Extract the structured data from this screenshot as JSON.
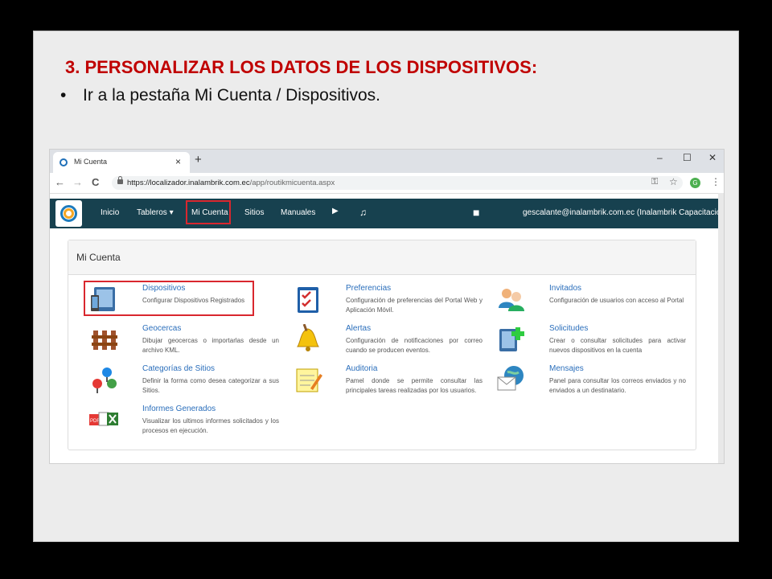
{
  "slide": {
    "title": "3. PERSONALIZAR LOS DATOS DE LOS DISPOSITIVOS:",
    "bullet_symbol": "•",
    "bullet_text": "Ir a la pestaña Mi Cuenta / Dispositivos."
  },
  "browser": {
    "tab_title": "Mi Cuenta",
    "tab_close": "×",
    "new_tab": "+",
    "minimize": "–",
    "maximize": "☐",
    "close": "✕",
    "back": "←",
    "forward": "→",
    "reload": "C",
    "url_main": "https://localizador.inalambrik.com.ec",
    "url_path": "/app/routikmicuenta.aspx",
    "key_icon": "⚿",
    "star_icon": "☆",
    "avatar_letter": "G",
    "menu_icon": "⋮"
  },
  "nav": {
    "items": [
      "Inicio",
      "Tableros ▾",
      "Mi Cuenta",
      "Sitios",
      "Manuales"
    ],
    "youtube_icon": "▶",
    "support_icon": "♫",
    "chat_icon": "■",
    "user": "gescalante@inalambrik.com.ec (Inalambrik Capacitación) ▾"
  },
  "panel": {
    "title": "Mi Cuenta",
    "items": [
      {
        "title": "Dispositivos",
        "desc": "Configurar Dispositivos Registrados"
      },
      {
        "title": "Geocercas",
        "desc": "Dibujar geocercas o importarlas desde un archivo KML."
      },
      {
        "title": "Categorías de Sitios",
        "desc": "Definir la forma como desea categorizar a sus Sitios."
      },
      {
        "title": "Informes Generados",
        "desc": "Visualizar los ultimos informes solicitados y los procesos en ejecución."
      },
      {
        "title": "Preferencias",
        "desc": "Configuración de preferencias del Portal Web y Aplicación Móvil."
      },
      {
        "title": "Alertas",
        "desc": "Configuración de notificaciones por correo cuando se producen eventos."
      },
      {
        "title": "Auditoria",
        "desc": "Pamel donde se permite consultar las principales tareas realizadas por los usuarios."
      },
      {
        "title": "Invitados",
        "desc": "Configuración de usuarios con acceso al Portal"
      },
      {
        "title": "Solicitudes",
        "desc": "Crear o consultar solicitudes para activar nuevos dispositivos en la cuenta"
      },
      {
        "title": "Mensajes",
        "desc": "Panel para consultar los correos enviados y no enviados a un destinatario."
      }
    ],
    "pdf_label": "PDF"
  }
}
